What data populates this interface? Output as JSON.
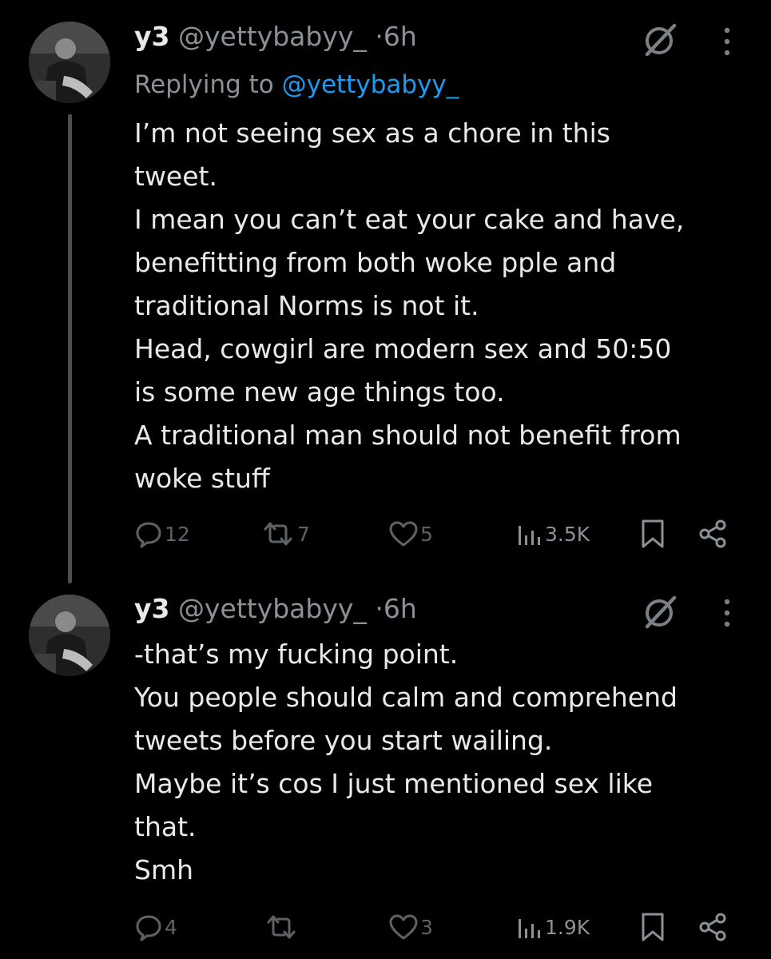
{
  "tweets": [
    {
      "name": "y3",
      "handle": "@yettybabyy_",
      "separator": "·",
      "time": "6h",
      "replying_prefix": "Replying to",
      "replying_to": "@yettybabyy_",
      "lines": [
        "I’m not seeing sex as a chore in this",
        "tweet.",
        "I mean you can’t eat your cake and have,",
        "benefitting from both woke pple and",
        "traditional Norms is not it.",
        "Head, cowgirl are modern sex and 50:50",
        "is some new age things too.",
        "A traditional man should not benefit from",
        "woke stuff"
      ],
      "replies": "12",
      "reposts": "7",
      "likes": "5",
      "views": "3.5K"
    },
    {
      "name": "y3",
      "handle": "@yettybabyy_",
      "separator": "·",
      "time": "6h",
      "lines": [
        "-that’s my fucking point.",
        "You people should calm and comprehend",
        "tweets before you start wailing.",
        "Maybe it’s cos I just mentioned sex like",
        "that.",
        "Smh"
      ],
      "replies": "4",
      "reposts": "",
      "likes": "3",
      "views": "1.9K"
    }
  ],
  "icons": {
    "grok": "grok-icon",
    "more": "more-dots-icon",
    "reply": "reply-bubble-icon",
    "repost": "repost-icon",
    "like": "heart-icon",
    "views": "views-bar-chart-icon",
    "bookmark": "bookmark-icon",
    "share": "share-icon"
  },
  "colors": {
    "background": "#000000",
    "text": "#e7e9ea",
    "secondary": "#8b9196",
    "link": "#1d9bf0",
    "thread_line": "#4a4f53"
  }
}
